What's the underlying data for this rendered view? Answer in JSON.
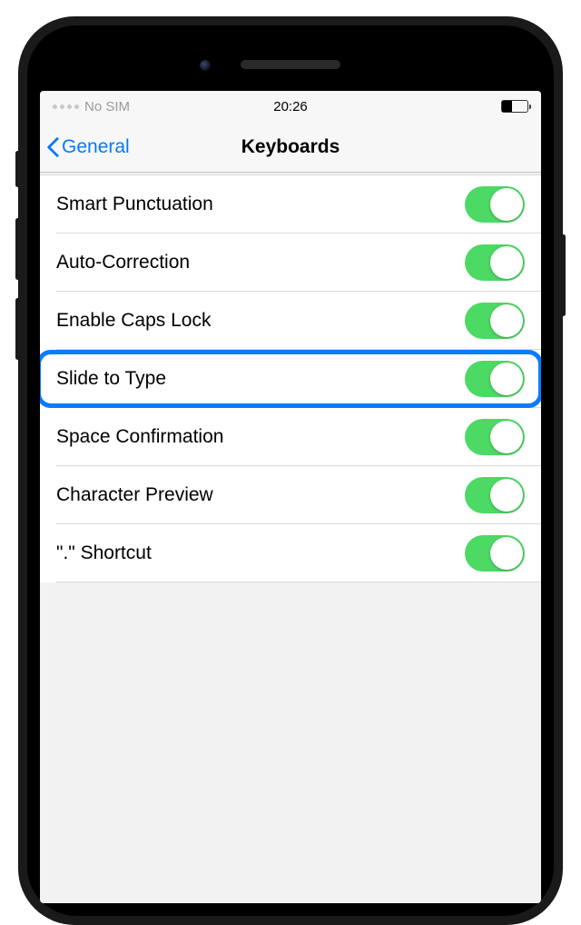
{
  "status": {
    "carrier": "No SIM",
    "time": "20:26"
  },
  "nav": {
    "back_label": "General",
    "title": "Keyboards"
  },
  "rows": [
    {
      "label": "Smart Punctuation",
      "on": true
    },
    {
      "label": "Auto-Correction",
      "on": true
    },
    {
      "label": "Enable Caps Lock",
      "on": true
    },
    {
      "label": "Slide to Type",
      "on": true,
      "highlighted": true
    },
    {
      "label": "Space Confirmation",
      "on": true
    },
    {
      "label": "Character Preview",
      "on": true
    },
    {
      "label": "\".\" Shortcut",
      "on": true
    }
  ],
  "colors": {
    "accent": "#007aff",
    "toggle_on": "#4cd964",
    "highlight": "#0a7cff"
  }
}
